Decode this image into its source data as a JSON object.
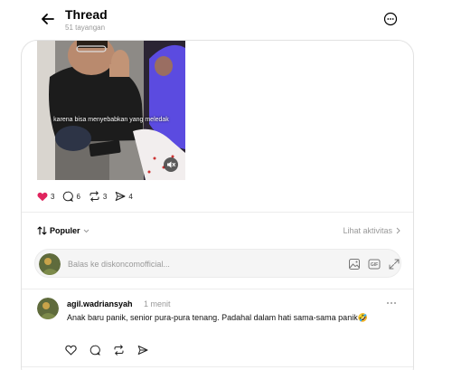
{
  "header": {
    "title": "Thread",
    "views": "51 tayangan",
    "icons": {
      "back": "back-arrow-icon",
      "more": "more-circle-icon"
    }
  },
  "post": {
    "video_caption": "karena bisa menyebabkan yang meledak",
    "likes": "3",
    "comments": "6",
    "reposts": "3",
    "shares": "4",
    "liked": true,
    "like_color": "#e0245e"
  },
  "sort": {
    "label": "Populer",
    "activity_label": "Lihat aktivitas"
  },
  "reply": {
    "placeholder": "Balas ke diskoncomofficial..."
  },
  "comment": {
    "username": "agil.wadriansyah",
    "time": "1 menit",
    "text": "Anak baru panik, senior pura-pura tenang. Padahal dalam hati sama-sama panik🤣"
  }
}
